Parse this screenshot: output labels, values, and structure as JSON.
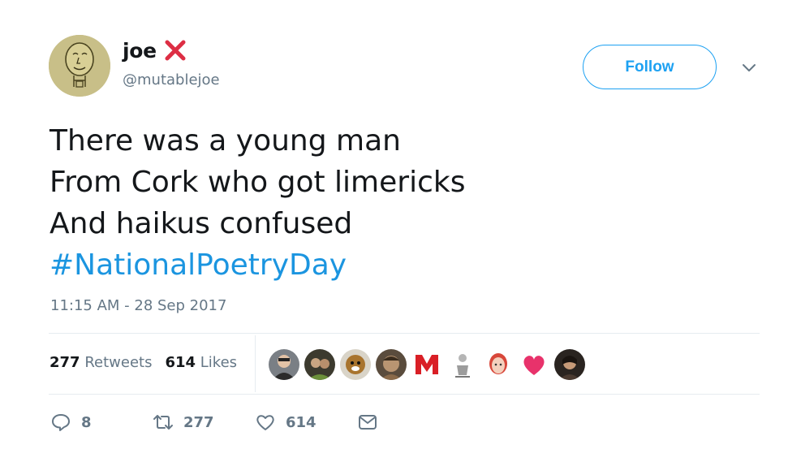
{
  "user": {
    "display_name": "joe",
    "name_emoji": "cross-mark-emoji",
    "handle": "@mutablejoe"
  },
  "follow_label": "Follow",
  "tweet": {
    "lines": [
      "There was a young man",
      "From Cork who got limericks",
      "And haikus confused"
    ],
    "hashtag": "#NationalPoetryDay"
  },
  "timestamp": "11:15 AM - 28 Sep 2017",
  "stats": {
    "retweets_count": "277",
    "retweets_label": "Retweets",
    "likes_count": "614",
    "likes_label": "Likes"
  },
  "likers_count_shown": 9,
  "actions": {
    "reply_count": "8",
    "retweet_count": "277",
    "like_count": "614"
  },
  "colors": {
    "accent": "#1da1f2",
    "hashtag": "#1b95e0",
    "muted": "#657786",
    "text": "#14171a",
    "heart": "#e0245e"
  },
  "icons": [
    "reply-icon",
    "retweet-icon",
    "like-icon",
    "message-icon",
    "chevron-down-icon"
  ]
}
